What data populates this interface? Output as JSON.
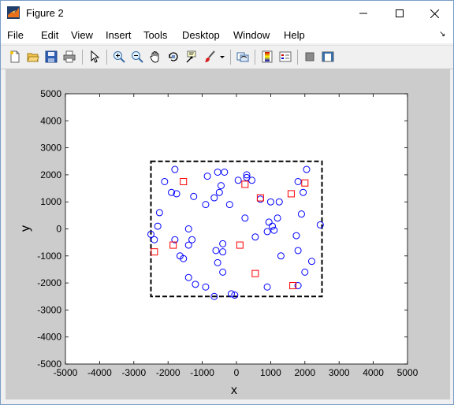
{
  "window": {
    "title": "Figure 2"
  },
  "menu": {
    "items": [
      {
        "key": "file",
        "label": "File"
      },
      {
        "key": "edit",
        "label": "Edit"
      },
      {
        "key": "view",
        "label": "View"
      },
      {
        "key": "insert",
        "label": "Insert"
      },
      {
        "key": "tools",
        "label": "Tools"
      },
      {
        "key": "desktop",
        "label": "Desktop"
      },
      {
        "key": "window",
        "label": "Window"
      },
      {
        "key": "help",
        "label": "Help"
      }
    ]
  },
  "toolbar": {
    "buttons": [
      "new-figure-icon",
      "open-file-icon",
      "save-icon",
      "print-icon",
      "pointer-icon",
      "zoom-in-icon",
      "zoom-out-icon",
      "pan-icon",
      "rotate-3d-icon",
      "data-cursor-icon",
      "brush-icon",
      "brush-dropdown-icon",
      "link-plot-icon",
      "colorbar-icon",
      "legend-icon",
      "hide-plot-tools-icon",
      "show-plot-tools-icon"
    ]
  },
  "chart_data": {
    "type": "scatter",
    "xlabel": "x",
    "ylabel": "y",
    "xlim": [
      -5000,
      5000
    ],
    "ylim": [
      -5000,
      5000
    ],
    "xticks": [
      -5000,
      -4000,
      -3000,
      -2000,
      -1000,
      0,
      1000,
      2000,
      3000,
      4000,
      5000
    ],
    "yticks": [
      -5000,
      -4000,
      -3000,
      -2000,
      -1000,
      0,
      1000,
      2000,
      3000,
      4000,
      5000
    ],
    "grid": false,
    "colors": {
      "circles": "#0000ff",
      "squares": "#ff0000",
      "boundary": "#000000"
    },
    "boundary": {
      "style": "dashed",
      "x": [
        -2500,
        2500
      ],
      "y": [
        -2500,
        2500
      ]
    },
    "series": [
      {
        "marker": "circle",
        "points": [
          [
            -1800,
            2200
          ],
          [
            -2100,
            1750
          ],
          [
            -1900,
            1350
          ],
          [
            -1750,
            1300
          ],
          [
            -2250,
            600
          ],
          [
            -2300,
            100
          ],
          [
            -2500,
            -200
          ],
          [
            -2400,
            -400
          ],
          [
            -1800,
            -400
          ],
          [
            -1650,
            -1000
          ],
          [
            -1550,
            -1100
          ],
          [
            -1400,
            0
          ],
          [
            -1300,
            -400
          ],
          [
            -1400,
            -600
          ],
          [
            -1250,
            1200
          ],
          [
            -850,
            1950
          ],
          [
            -550,
            2100
          ],
          [
            -350,
            2100
          ],
          [
            -450,
            1600
          ],
          [
            -500,
            1350
          ],
          [
            -650,
            1150
          ],
          [
            -900,
            900
          ],
          [
            -200,
            900
          ],
          [
            -1400,
            -1800
          ],
          [
            -1200,
            -2050
          ],
          [
            -900,
            -2150
          ],
          [
            -650,
            -2500
          ],
          [
            -150,
            -2400
          ],
          [
            -50,
            -2450
          ],
          [
            -400,
            -1600
          ],
          [
            -400,
            -550
          ],
          [
            -400,
            -850
          ],
          [
            -600,
            -800
          ],
          [
            -550,
            -1250
          ],
          [
            50,
            1800
          ],
          [
            300,
            2000
          ],
          [
            300,
            1900
          ],
          [
            450,
            1800
          ],
          [
            250,
            400
          ],
          [
            550,
            -300
          ],
          [
            700,
            1100
          ],
          [
            900,
            -2150
          ],
          [
            950,
            250
          ],
          [
            900,
            -100
          ],
          [
            1000,
            1000
          ],
          [
            1050,
            100
          ],
          [
            1100,
            -50
          ],
          [
            1200,
            400
          ],
          [
            1250,
            1000
          ],
          [
            1300,
            -1000
          ],
          [
            1750,
            -250
          ],
          [
            1800,
            1750
          ],
          [
            1800,
            -800
          ],
          [
            1900,
            550
          ],
          [
            1950,
            1350
          ],
          [
            2000,
            -1600
          ],
          [
            2050,
            2200
          ],
          [
            2200,
            -1200
          ],
          [
            2450,
            150
          ],
          [
            1800,
            -2100
          ]
        ]
      },
      {
        "marker": "square",
        "points": [
          [
            -2400,
            -850
          ],
          [
            -1850,
            -600
          ],
          [
            -1550,
            1750
          ],
          [
            250,
            1650
          ],
          [
            700,
            1150
          ],
          [
            1600,
            1300
          ],
          [
            2000,
            1700
          ],
          [
            100,
            -600
          ],
          [
            550,
            -1650
          ],
          [
            1650,
            -2100
          ]
        ]
      }
    ]
  }
}
